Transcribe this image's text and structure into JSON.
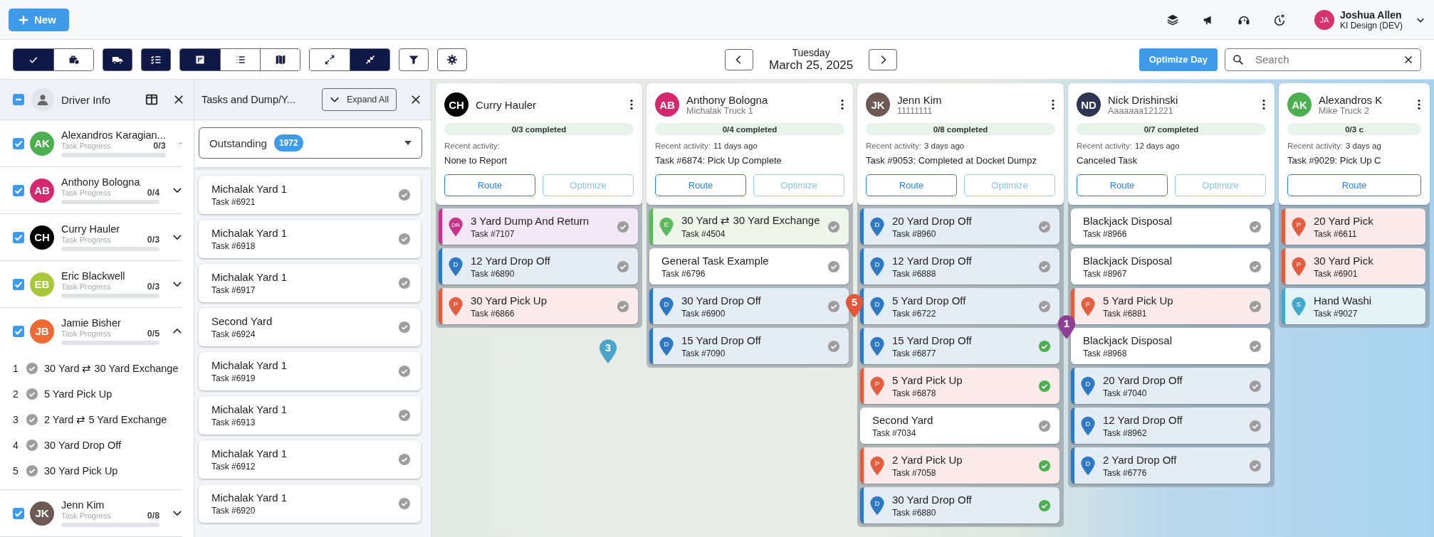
{
  "header": {
    "new_button": "New",
    "user": {
      "initials": "JA",
      "color": "#d6336c",
      "name": "Joshua Allen",
      "org": "KI Design (DEV)"
    }
  },
  "toolbar": {
    "groups": [
      {
        "buttons": [
          {
            "selected": true
          },
          {
            "selected": false
          }
        ]
      },
      {
        "buttons": [
          {
            "selected": true
          }
        ]
      },
      {
        "buttons": [
          {
            "selected": true
          }
        ]
      },
      {
        "buttons": [
          {
            "selected": true
          },
          {
            "selected": false
          },
          {
            "selected": false
          }
        ]
      },
      {
        "buttons": [
          {
            "selected": false
          },
          {
            "selected": true
          }
        ]
      },
      {
        "buttons": [
          {
            "selected": false
          }
        ]
      },
      {
        "buttons": [
          {
            "selected": false
          }
        ]
      }
    ],
    "day": "Tuesday",
    "date": "March 25, 2025",
    "optimize_button": "Optimize Day",
    "search": {
      "placeholder": "Search"
    }
  },
  "driver_panel": {
    "title": "Driver Info",
    "partially_checked": true,
    "drivers": [
      {
        "initials": "AK",
        "color": "#4caf50",
        "name": "Alexandros Karagian...",
        "progress_label": "Task Progress",
        "progress": "0/3",
        "level": 0,
        "checked": true,
        "expanded": false
      },
      {
        "initials": "AB",
        "color": "#d6286f",
        "name": "Anthony Bologna",
        "progress_label": "Task Progress",
        "progress": "0/4",
        "level": 0,
        "checked": true,
        "expanded": false
      },
      {
        "initials": "CH",
        "color": "#000000",
        "name": "Curry Hauler",
        "progress_label": "Task Progress",
        "progress": "0/3",
        "level": 0,
        "checked": true,
        "expanded": false
      },
      {
        "initials": "EB",
        "color": "#a8c83a",
        "name": "Eric Blackwell",
        "progress_label": "Task Progress",
        "progress": "0/3",
        "level": 0,
        "checked": true,
        "expanded": false
      },
      {
        "initials": "JB",
        "color": "#ee6a35",
        "name": "Jamie Bisher",
        "progress_label": "Task Progress",
        "progress": "0/5",
        "level": 0,
        "checked": true,
        "expanded": true,
        "tasks": [
          {
            "number": "1",
            "name": "30 Yard ⇄ 30 Yard Exchange",
            "done": false
          },
          {
            "number": "2",
            "name": "5 Yard Pick Up",
            "done": false
          },
          {
            "number": "3",
            "name": "2 Yard ⇄ 5 Yard Exchange",
            "done": false
          },
          {
            "number": "4",
            "name": "30 Yard Drop Off",
            "done": false
          },
          {
            "number": "5",
            "name": "30 Yard Pick Up",
            "done": false
          }
        ]
      },
      {
        "initials": "JK",
        "color": "#6d5a54",
        "name": "Jenn Kim",
        "progress_label": "Task Progress",
        "progress": "0/8",
        "level": 0,
        "checked": true,
        "expanded": false
      }
    ]
  },
  "tasks_panel": {
    "title": "Tasks and Dump/Y...",
    "expand_button": "Expand All",
    "filter": {
      "value": "Outstanding",
      "count": "1972"
    },
    "tasks": [
      {
        "name": "Michalak Yard 1",
        "number": "Task #6921",
        "done": false
      },
      {
        "name": "Michalak Yard 1",
        "number": "Task #6918",
        "done": false
      },
      {
        "name": "Michalak Yard 1",
        "number": "Task #6917",
        "done": false
      },
      {
        "name": "Second Yard",
        "number": "Task #6924",
        "done": false
      },
      {
        "name": "Michalak Yard 1",
        "number": "Task #6919",
        "done": false
      },
      {
        "name": "Michalak Yard 1",
        "number": "Task #6913",
        "done": false
      },
      {
        "name": "Michalak Yard 1",
        "number": "Task #6912",
        "done": false
      },
      {
        "name": "Michalak Yard 1",
        "number": "Task #6920",
        "done": false
      }
    ]
  },
  "map": {
    "markers": [
      {
        "label": "3",
        "color": "#4aa6c9"
      },
      {
        "label": "5",
        "color": "#e3573a"
      },
      {
        "label": "1",
        "color": "#8e3f96"
      }
    ]
  },
  "routes": [
    {
      "initials": "CH",
      "color": "#000000",
      "name": "Curry Hauler",
      "progress": "0/3 completed",
      "level": 0,
      "activity_label": "Recent activity:",
      "activity": "None to Report",
      "route_button": "Route",
      "optimize_button": "Optimize",
      "tasks": [
        {
          "kind": "dump",
          "pin": "DR",
          "name": "3 Yard Dump And Return",
          "number": "Task #7107",
          "done": false
        },
        {
          "kind": "drop",
          "pin": "D",
          "name": "12 Yard Drop Off",
          "number": "Task #6890",
          "done": false
        },
        {
          "kind": "pickup",
          "pin": "P",
          "name": "30 Yard Pick Up",
          "number": "Task #6866",
          "done": false
        }
      ]
    },
    {
      "initials": "AB",
      "color": "#d6286f",
      "name": "Anthony Bologna",
      "vehicle": "Michalak Truck 1",
      "progress": "0/4 completed",
      "level": 0,
      "activity_label": "Recent activity:",
      "activity_when": "11 days ago",
      "activity": "Task #6874: Pick Up Complete",
      "route_button": "Route",
      "optimize_button": "Optimize",
      "tasks": [
        {
          "kind": "exchange",
          "pin": "E",
          "name": "30 Yard ⇄ 30 Yard Exchange",
          "number": "Task #4504",
          "done": false
        },
        {
          "kind": "yard",
          "name": "General Task Example",
          "number": "Task #6796",
          "done": false
        },
        {
          "kind": "drop",
          "pin": "D",
          "name": "30 Yard Drop Off",
          "number": "Task #6900",
          "done": false
        },
        {
          "kind": "drop",
          "pin": "D",
          "name": "15 Yard Drop Off",
          "number": "Task #7090",
          "done": false
        }
      ]
    },
    {
      "initials": "JK",
      "color": "#6d5a54",
      "name": "Jenn Kim",
      "vehicle": "11111111",
      "progress": "0/8 completed",
      "level": 0,
      "activity_label": "Recent activity:",
      "activity_when": "3 days ago",
      "activity": "Task #9053: Completed at Docket Dumpz",
      "route_button": "Route",
      "optimize_button": "Optimize",
      "tasks": [
        {
          "kind": "drop",
          "pin": "D",
          "name": "20 Yard Drop Off",
          "number": "Task #8960",
          "done": false
        },
        {
          "kind": "drop",
          "pin": "D",
          "name": "12 Yard Drop Off",
          "number": "Task #6888",
          "done": false
        },
        {
          "kind": "drop",
          "pin": "D",
          "name": "5 Yard Drop Off",
          "number": "Task #6722",
          "done": false
        },
        {
          "kind": "drop",
          "pin": "D",
          "name": "15 Yard Drop Off",
          "number": "Task #6877",
          "done": true
        },
        {
          "kind": "pickup",
          "pin": "P",
          "name": "5 Yard Pick Up",
          "number": "Task #6878",
          "done": true
        },
        {
          "kind": "yard",
          "name": "Second Yard",
          "number": "Task #7034",
          "done": false
        },
        {
          "kind": "pickup",
          "pin": "P",
          "name": "2 Yard Pick Up",
          "number": "Task #7058",
          "done": true
        },
        {
          "kind": "drop",
          "pin": "D",
          "name": "30 Yard Drop Off",
          "number": "Task #6880",
          "done": true
        }
      ]
    },
    {
      "initials": "ND",
      "color": "#2e3552",
      "name": "Nick Drishinski",
      "vehicle": "Aaaaaaa121221",
      "progress": "0/7 completed",
      "level": 0,
      "activity_label": "Recent activity:",
      "activity_when": "12 days ago",
      "activity": "Canceled Task",
      "route_button": "Route",
      "optimize_button": "Optimize",
      "tasks": [
        {
          "kind": "yard",
          "name": "Blackjack Disposal",
          "number": "Task #8966",
          "done": false
        },
        {
          "kind": "yard",
          "name": "Blackjack Disposal",
          "number": "Task #8967",
          "done": false
        },
        {
          "kind": "pickup",
          "pin": "P",
          "name": "5 Yard Pick Up",
          "number": "Task #6881",
          "done": false
        },
        {
          "kind": "yard",
          "name": "Blackjack Disposal",
          "number": "Task #8968",
          "done": false
        },
        {
          "kind": "drop",
          "pin": "D",
          "name": "20 Yard Drop Off",
          "number": "Task #7040",
          "done": false
        },
        {
          "kind": "drop",
          "pin": "D",
          "name": "12 Yard Drop Off",
          "number": "Task #8962",
          "done": false
        },
        {
          "kind": "drop",
          "pin": "D",
          "name": "2 Yard Drop Off",
          "number": "Task #6776",
          "done": false
        }
      ]
    },
    {
      "initials": "AK",
      "color": "#4caf50",
      "name": "Alexandros K",
      "vehicle": "Mike Truck 2",
      "progress": "0/3 c",
      "level": 0,
      "activity_label": "Recent activity:",
      "activity_when": "3 days ag",
      "activity": "Task #9029: Pick Up C",
      "route_button": "Route",
      "tasks": [
        {
          "kind": "pickup",
          "pin": "P",
          "name": "20 Yard Pick",
          "number": "Task #6611"
        },
        {
          "kind": "pickup",
          "pin": "P",
          "name": "30 Yard Pick",
          "number": "Task #6901"
        },
        {
          "kind": "service",
          "pin": "S",
          "name": "Hand Washi",
          "number": "Task #9027"
        }
      ]
    }
  ]
}
